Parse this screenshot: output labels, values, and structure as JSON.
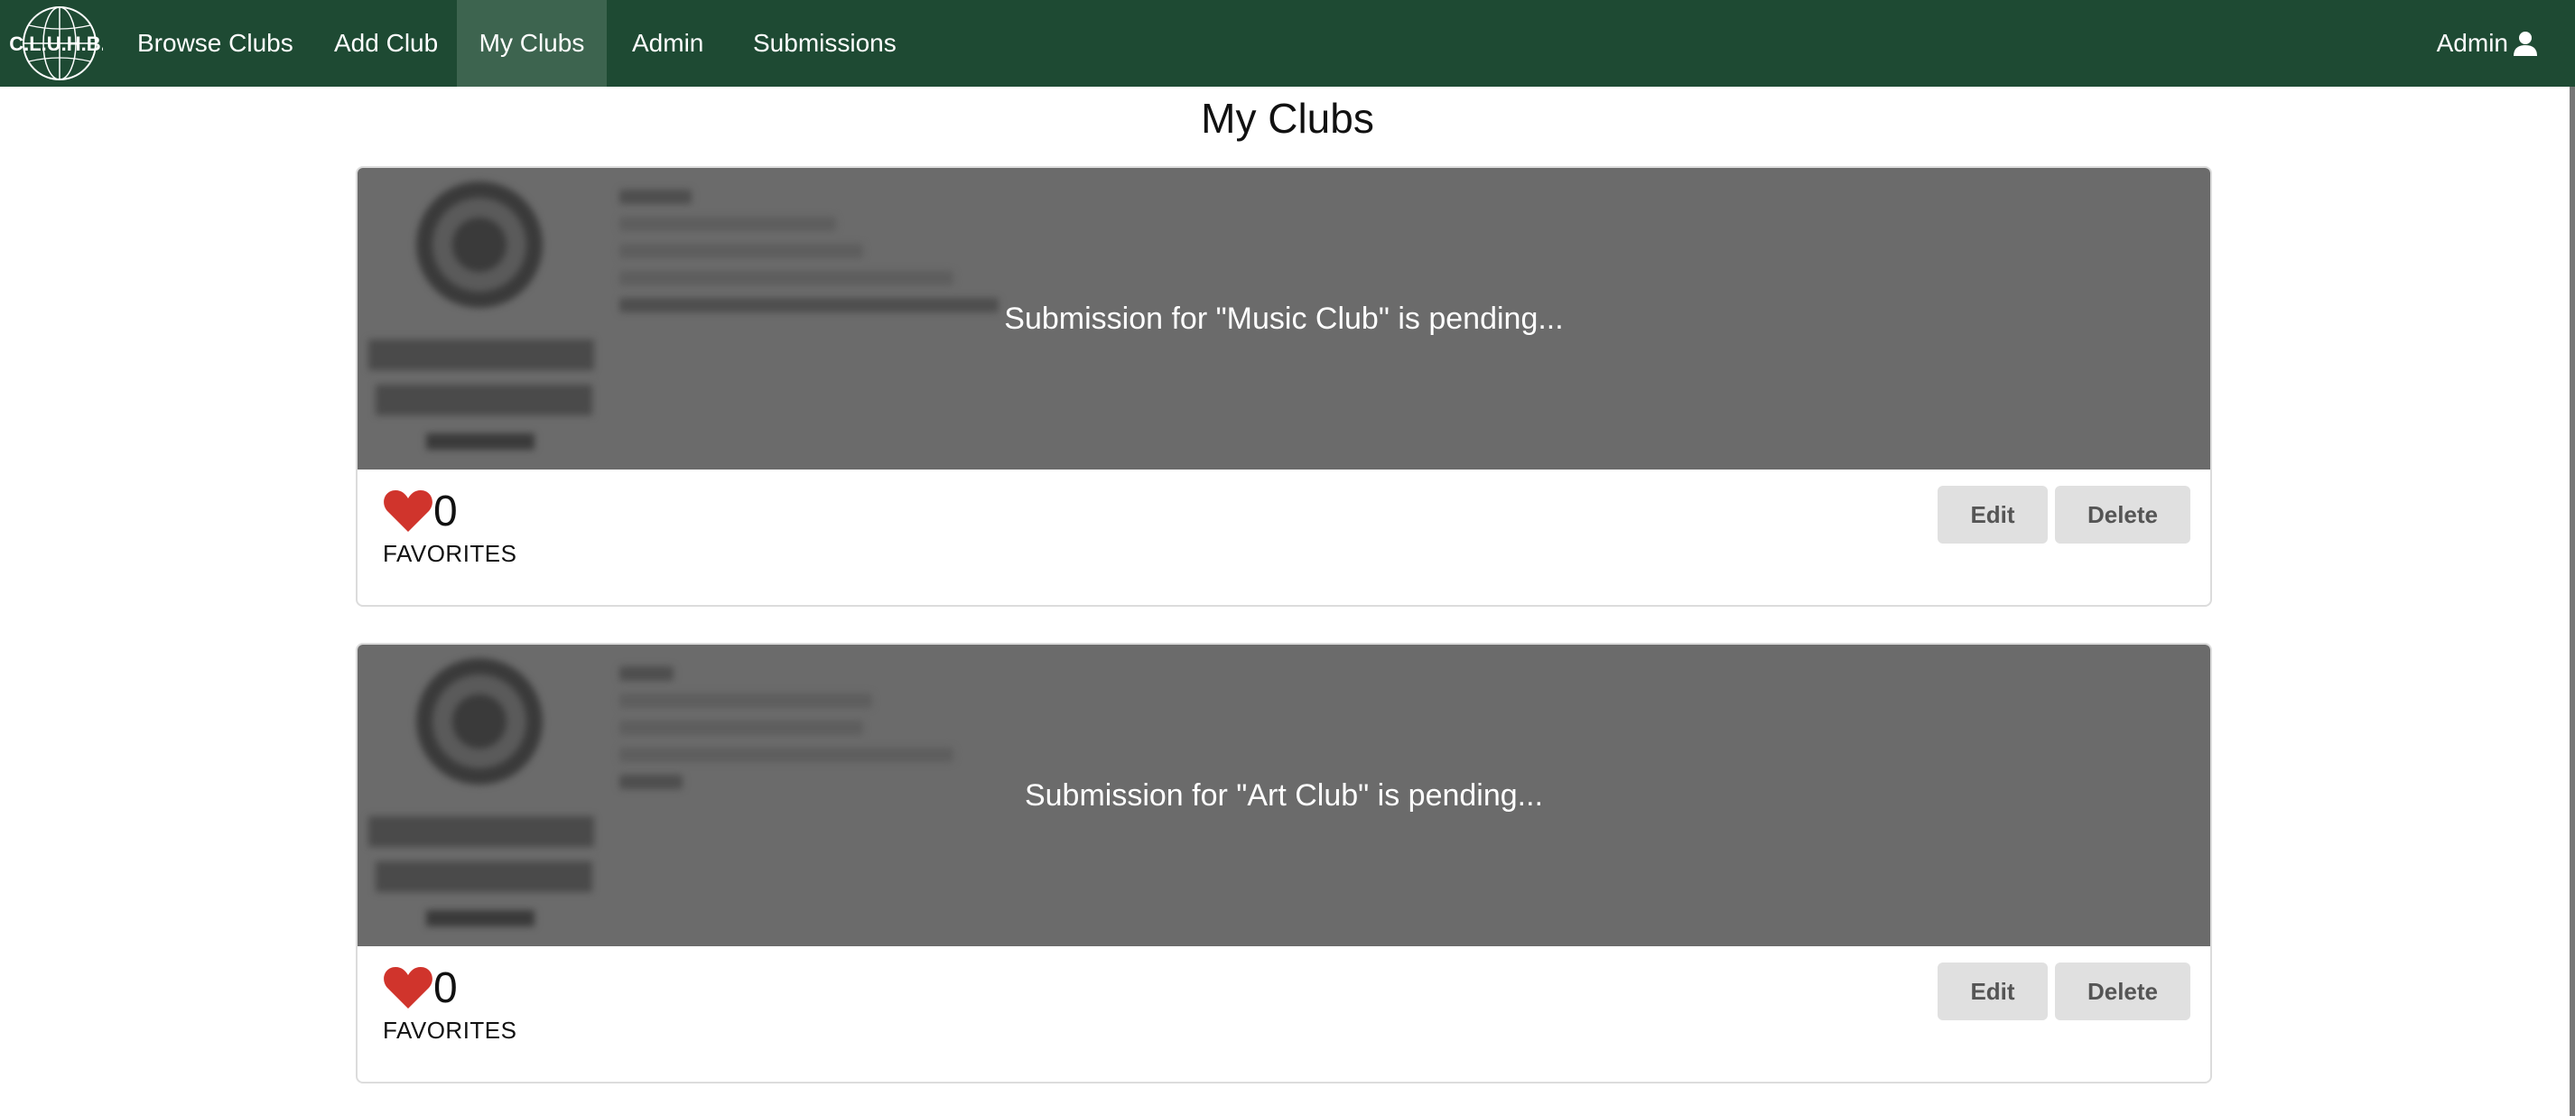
{
  "navbar": {
    "brand_text": "C.L.U.H.B.",
    "items": [
      {
        "label": "Browse Clubs"
      },
      {
        "label": "Add Club"
      },
      {
        "label": "My Clubs",
        "active": true
      },
      {
        "label": "Admin"
      },
      {
        "label": "Submissions"
      }
    ],
    "user_label": "Admin",
    "user_icon": "user-icon",
    "background": "#1e4a33"
  },
  "page": {
    "title": "My Clubs"
  },
  "clubs": [
    {
      "pending_text": "Submission for \"Music Club\" is pending...",
      "favorites_count": "0",
      "favorites_label": "FAVORITES",
      "edit_label": "Edit",
      "delete_label": "Delete"
    },
    {
      "pending_text": "Submission for \"Art Club\" is pending...",
      "favorites_count": "0",
      "favorites_label": "FAVORITES",
      "edit_label": "Edit",
      "delete_label": "Delete"
    }
  ],
  "colors": {
    "heart": "#d0342c",
    "overlay": "#6b6b6b",
    "active_nav": "#3d644f"
  }
}
